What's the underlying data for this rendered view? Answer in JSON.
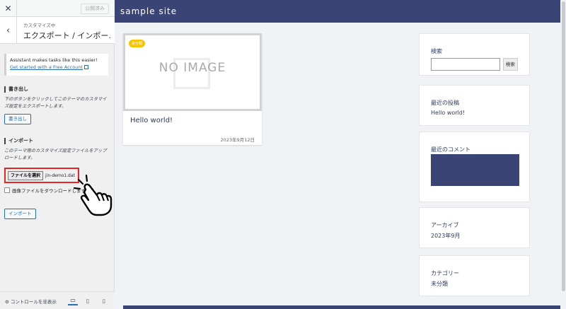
{
  "customizer": {
    "close_icon": "close-icon",
    "published_label": "公開済み",
    "back_icon": "chevron-left-icon",
    "breadcrumb": "カスタマイズ中",
    "section_title": "エクスポート / インポー…",
    "notice": {
      "text": "Assistant makes tasks like this easier!",
      "link": "Get started with a Free Account"
    },
    "export": {
      "title": "書き出し",
      "description": "下のボタンをクリックしてこのテーマのカスタマイズ設定をエクスポートします。",
      "button": "書き出し"
    },
    "import": {
      "title": "インポート",
      "description": "このテーマ用のカスタマイズ設定ファイルをアップロードします。",
      "file_button": "ファイルを選択",
      "file_name": "jin-demo1.dat",
      "checkbox_label": "画像ファイルをダウンロードしますか？",
      "checkbox_checked": false,
      "button": "インポート"
    },
    "footer": {
      "hide_controls": "コントロールを非表示",
      "devices": [
        "desktop-icon",
        "tablet-icon",
        "mobile-icon"
      ],
      "active_device": "desktop"
    }
  },
  "preview": {
    "site_title": "sample site",
    "header_color": "#3a4575",
    "post": {
      "category": "未分類",
      "no_image_text": "NO IMAGE",
      "title": "Hello world!",
      "date": "2023年9月12日"
    },
    "widgets": {
      "search": {
        "title": "検索",
        "button": "検索"
      },
      "recent_posts": {
        "title": "最近の投稿",
        "items": [
          "Hello world!"
        ]
      },
      "recent_comments": {
        "title": "最近のコメント"
      },
      "archives": {
        "title": "アーカイブ",
        "items": [
          "2023年9月"
        ]
      },
      "categories": {
        "title": "カテゴリー",
        "items": [
          "未分類"
        ]
      }
    }
  },
  "highlight_color": "#e32626"
}
